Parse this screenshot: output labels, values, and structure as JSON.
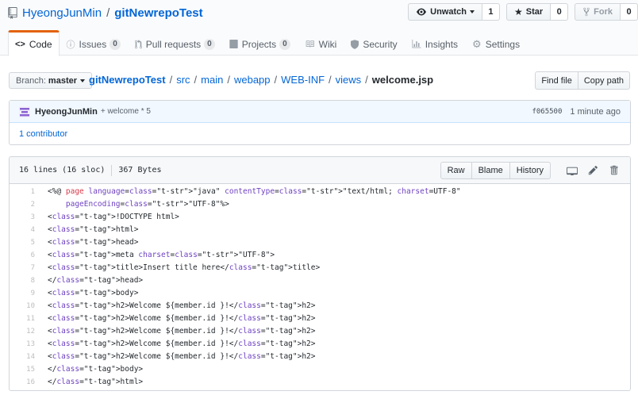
{
  "repo": {
    "owner": "HyeongJunMin",
    "separator": "/",
    "name": "gitNewrepoTest"
  },
  "actions": {
    "watch_label": "Unwatch",
    "watch_count": "1",
    "star_label": "Star",
    "star_count": "0",
    "fork_label": "Fork",
    "fork_count": "0"
  },
  "nav": {
    "code": "Code",
    "issues": "Issues",
    "issues_count": "0",
    "pulls": "Pull requests",
    "pulls_count": "0",
    "projects": "Projects",
    "projects_count": "0",
    "wiki": "Wiki",
    "security": "Security",
    "insights": "Insights",
    "settings": "Settings"
  },
  "branch": {
    "prefix": "Branch:",
    "name": "master"
  },
  "breadcrumb": {
    "parts": [
      "gitNewrepoTest",
      "src",
      "main",
      "webapp",
      "WEB-INF",
      "views"
    ],
    "file": "welcome.jsp"
  },
  "file_nav": {
    "find_file": "Find file",
    "copy_path": "Copy path"
  },
  "commit": {
    "author": "HyeongJunMin",
    "message": "+ welcome * 5",
    "sha": "f065500",
    "time": "1 minute ago",
    "contributors": "1 contributor"
  },
  "file": {
    "lines_info": "16 lines (16 sloc)",
    "size": "367 Bytes",
    "raw": "Raw",
    "blame": "Blame",
    "history": "History",
    "lines": [
      "<%@ page language=\"java\" contentType=\"text/html; charset=UTF-8\"",
      "    pageEncoding=\"UTF-8\"%>",
      "<!DOCTYPE html>",
      "<html>",
      "<head>",
      "<meta charset=\"UTF-8\">",
      "<title>Insert title here</title>",
      "</head>",
      "<body>",
      "<h2>Welcome ${member.id }!</h2>",
      "<h2>Welcome ${member.id }!</h2>",
      "<h2>Welcome ${member.id }!</h2>",
      "<h2>Welcome ${member.id }!</h2>",
      "<h2>Welcome ${member.id }!</h2>",
      "</body>",
      "</html>"
    ]
  },
  "colors": {
    "link": "#0366d6",
    "selected_tab_accent": "#e36209",
    "commit_bg": "#f1f8ff"
  },
  "icons": {
    "repo": "repo-icon",
    "eye": "eye-icon",
    "star": "star-icon",
    "fork": "fork-icon",
    "code": "code-icon",
    "issue": "issue-icon",
    "pull": "pull-request-icon",
    "project": "project-icon",
    "wiki": "book-icon",
    "security": "shield-icon",
    "insights": "graph-icon",
    "settings": "gear-icon",
    "desktop": "desktop-icon",
    "edit": "pencil-icon",
    "delete": "trash-icon"
  }
}
